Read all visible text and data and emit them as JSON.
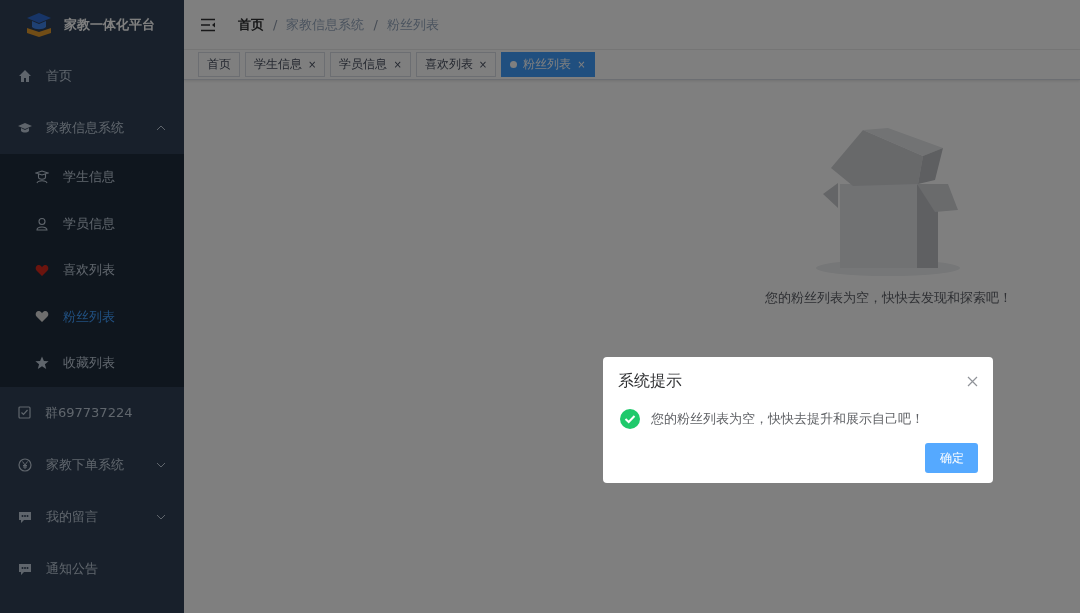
{
  "sidebar": {
    "logo_title": "家教一体化平台",
    "items": [
      {
        "label": "首页",
        "selected": false
      },
      {
        "label": "家教信息系统",
        "selected": false,
        "expanded": true,
        "children": [
          {
            "label": "学生信息",
            "selected": false
          },
          {
            "label": "学员信息",
            "selected": false
          },
          {
            "label": "喜欢列表",
            "selected": false
          },
          {
            "label": "粉丝列表",
            "selected": true
          },
          {
            "label": "收藏列表",
            "selected": false
          }
        ]
      },
      {
        "label": "群697737224",
        "selected": false
      },
      {
        "label": "家教下单系统",
        "selected": false,
        "expanded": false
      },
      {
        "label": "我的留言",
        "selected": false,
        "expanded": false
      },
      {
        "label": "通知公告",
        "selected": false
      }
    ]
  },
  "breadcrumb": [
    {
      "label": "首页"
    },
    {
      "separator": "/",
      "label": "家教信息系统"
    },
    {
      "separator": "/",
      "label": "粉丝列表"
    }
  ],
  "tags": [
    {
      "label": "首页",
      "selected": false
    },
    {
      "label": "学生信息",
      "close": "×",
      "selected": false
    },
    {
      "label": "学员信息",
      "close": "×",
      "selected": false
    },
    {
      "label": "喜欢列表",
      "close": "×",
      "selected": false
    },
    {
      "label": "粉丝列表",
      "close": "×",
      "selected": true
    }
  ],
  "empty_state": {
    "message": "您的粉丝列表为空，快快去发现和探索吧！"
  },
  "dialog": {
    "title": "系统提示",
    "message": "您的粉丝列表为空，快快去提升和展示自己吧！",
    "button": "确定"
  }
}
